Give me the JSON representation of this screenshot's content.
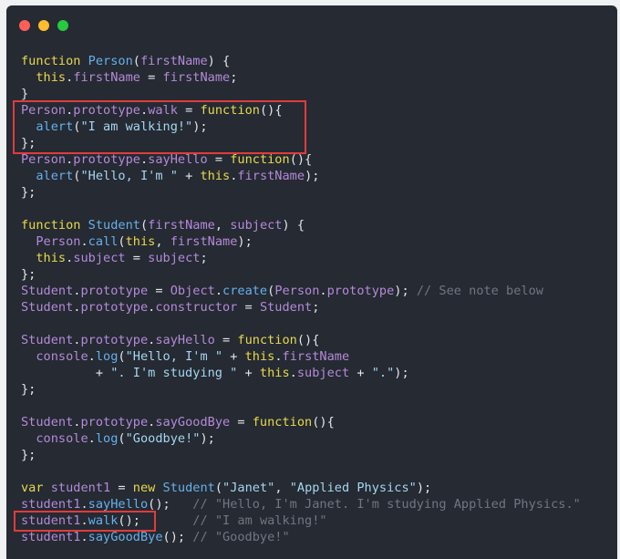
{
  "window": {
    "buttons": [
      {
        "name": "close",
        "color": "#ff5f57"
      },
      {
        "name": "minimize",
        "color": "#febc2e"
      },
      {
        "name": "maximize",
        "color": "#28c840"
      }
    ]
  },
  "colors": {
    "keyword": "#e8d94a",
    "function": "#67b0ea",
    "property": "#b58ad8",
    "string": "#a6d6f0",
    "comment": "#6f7782",
    "highlight": "#e23b3b"
  },
  "code": {
    "lines": [
      [
        [
          "kw",
          "function"
        ],
        [
          "op",
          " "
        ],
        [
          "fn",
          "Person"
        ],
        [
          "pu",
          "("
        ],
        [
          "prop",
          "firstName"
        ],
        [
          "pu",
          ") {"
        ]
      ],
      [
        [
          "op",
          "  "
        ],
        [
          "kw",
          "this"
        ],
        [
          "pu",
          "."
        ],
        [
          "prop",
          "firstName"
        ],
        [
          "op",
          " = "
        ],
        [
          "prop",
          "firstName"
        ],
        [
          "pu",
          ";"
        ]
      ],
      [
        [
          "pu",
          "}"
        ]
      ],
      [
        [
          "prop",
          "Person"
        ],
        [
          "pu",
          "."
        ],
        [
          "prop",
          "prototype"
        ],
        [
          "pu",
          "."
        ],
        [
          "prop",
          "walk"
        ],
        [
          "op",
          " = "
        ],
        [
          "kw",
          "function"
        ],
        [
          "pu",
          "(){"
        ]
      ],
      [
        [
          "op",
          "  "
        ],
        [
          "fn",
          "alert"
        ],
        [
          "pu",
          "("
        ],
        [
          "str",
          "\"I am walking!\""
        ],
        [
          "pu",
          ");"
        ]
      ],
      [
        [
          "pu",
          "};"
        ]
      ],
      [
        [
          "prop",
          "Person"
        ],
        [
          "pu",
          "."
        ],
        [
          "prop",
          "prototype"
        ],
        [
          "pu",
          "."
        ],
        [
          "prop",
          "sayHello"
        ],
        [
          "op",
          " = "
        ],
        [
          "kw",
          "function"
        ],
        [
          "pu",
          "(){"
        ]
      ],
      [
        [
          "op",
          "  "
        ],
        [
          "fn",
          "alert"
        ],
        [
          "pu",
          "("
        ],
        [
          "str",
          "\"Hello, I'm \""
        ],
        [
          "op",
          " + "
        ],
        [
          "kw",
          "this"
        ],
        [
          "pu",
          "."
        ],
        [
          "prop",
          "firstName"
        ],
        [
          "pu",
          ");"
        ]
      ],
      [
        [
          "pu",
          "};"
        ]
      ],
      [],
      [
        [
          "kw",
          "function"
        ],
        [
          "op",
          " "
        ],
        [
          "fn",
          "Student"
        ],
        [
          "pu",
          "("
        ],
        [
          "prop",
          "firstName"
        ],
        [
          "pu",
          ", "
        ],
        [
          "prop",
          "subject"
        ],
        [
          "pu",
          ") {"
        ]
      ],
      [
        [
          "op",
          "  "
        ],
        [
          "prop",
          "Person"
        ],
        [
          "pu",
          "."
        ],
        [
          "fn",
          "call"
        ],
        [
          "pu",
          "("
        ],
        [
          "kw",
          "this"
        ],
        [
          "pu",
          ", "
        ],
        [
          "prop",
          "firstName"
        ],
        [
          "pu",
          ");"
        ]
      ],
      [
        [
          "op",
          "  "
        ],
        [
          "kw",
          "this"
        ],
        [
          "pu",
          "."
        ],
        [
          "prop",
          "subject"
        ],
        [
          "op",
          " = "
        ],
        [
          "prop",
          "subject"
        ],
        [
          "pu",
          ";"
        ]
      ],
      [
        [
          "pu",
          "};"
        ]
      ],
      [
        [
          "prop",
          "Student"
        ],
        [
          "pu",
          "."
        ],
        [
          "prop",
          "prototype"
        ],
        [
          "op",
          " = "
        ],
        [
          "prop",
          "Object"
        ],
        [
          "pu",
          "."
        ],
        [
          "fn",
          "create"
        ],
        [
          "pu",
          "("
        ],
        [
          "prop",
          "Person"
        ],
        [
          "pu",
          "."
        ],
        [
          "prop",
          "prototype"
        ],
        [
          "pu",
          ");"
        ],
        [
          "op",
          " "
        ],
        [
          "cm",
          "// See note below"
        ]
      ],
      [
        [
          "prop",
          "Student"
        ],
        [
          "pu",
          "."
        ],
        [
          "prop",
          "prototype"
        ],
        [
          "pu",
          "."
        ],
        [
          "prop",
          "constructor"
        ],
        [
          "op",
          " = "
        ],
        [
          "prop",
          "Student"
        ],
        [
          "pu",
          ";"
        ]
      ],
      [],
      [
        [
          "prop",
          "Student"
        ],
        [
          "pu",
          "."
        ],
        [
          "prop",
          "prototype"
        ],
        [
          "pu",
          "."
        ],
        [
          "prop",
          "sayHello"
        ],
        [
          "op",
          " = "
        ],
        [
          "kw",
          "function"
        ],
        [
          "pu",
          "(){"
        ]
      ],
      [
        [
          "op",
          "  "
        ],
        [
          "prop",
          "console"
        ],
        [
          "pu",
          "."
        ],
        [
          "fn",
          "log"
        ],
        [
          "pu",
          "("
        ],
        [
          "str",
          "\"Hello, I'm \""
        ],
        [
          "op",
          " + "
        ],
        [
          "kw",
          "this"
        ],
        [
          "pu",
          "."
        ],
        [
          "prop",
          "firstName"
        ]
      ],
      [
        [
          "op",
          "          + "
        ],
        [
          "str",
          "\". I'm studying \""
        ],
        [
          "op",
          " + "
        ],
        [
          "kw",
          "this"
        ],
        [
          "pu",
          "."
        ],
        [
          "prop",
          "subject"
        ],
        [
          "op",
          " + "
        ],
        [
          "str",
          "\".\""
        ],
        [
          "pu",
          ");"
        ]
      ],
      [
        [
          "pu",
          "};"
        ]
      ],
      [],
      [
        [
          "prop",
          "Student"
        ],
        [
          "pu",
          "."
        ],
        [
          "prop",
          "prototype"
        ],
        [
          "pu",
          "."
        ],
        [
          "prop",
          "sayGoodBye"
        ],
        [
          "op",
          " = "
        ],
        [
          "kw",
          "function"
        ],
        [
          "pu",
          "(){"
        ]
      ],
      [
        [
          "op",
          "  "
        ],
        [
          "prop",
          "console"
        ],
        [
          "pu",
          "."
        ],
        [
          "fn",
          "log"
        ],
        [
          "pu",
          "("
        ],
        [
          "str",
          "\"Goodbye!\""
        ],
        [
          "pu",
          ");"
        ]
      ],
      [
        [
          "pu",
          "};"
        ]
      ],
      [],
      [
        [
          "kw",
          "var"
        ],
        [
          "op",
          " "
        ],
        [
          "prop",
          "student1"
        ],
        [
          "op",
          " = "
        ],
        [
          "kw",
          "new"
        ],
        [
          "op",
          " "
        ],
        [
          "fn",
          "Student"
        ],
        [
          "pu",
          "("
        ],
        [
          "str",
          "\"Janet\""
        ],
        [
          "pu",
          ", "
        ],
        [
          "str",
          "\"Applied Physics\""
        ],
        [
          "pu",
          ");"
        ]
      ],
      [
        [
          "prop",
          "student1"
        ],
        [
          "pu",
          "."
        ],
        [
          "fn",
          "sayHello"
        ],
        [
          "pu",
          "();"
        ],
        [
          "op",
          "   "
        ],
        [
          "cm",
          "// \"Hello, I'm Janet. I'm studying Applied Physics.\""
        ]
      ],
      [
        [
          "prop",
          "student1"
        ],
        [
          "pu",
          "."
        ],
        [
          "fn",
          "walk"
        ],
        [
          "pu",
          "();"
        ],
        [
          "op",
          "       "
        ],
        [
          "cm",
          "// \"I am walking!\""
        ]
      ],
      [
        [
          "prop",
          "student1"
        ],
        [
          "pu",
          "."
        ],
        [
          "fn",
          "sayGoodBye"
        ],
        [
          "pu",
          "();"
        ],
        [
          "op",
          " "
        ],
        [
          "cm",
          "// \"Goodbye!\""
        ]
      ]
    ]
  }
}
